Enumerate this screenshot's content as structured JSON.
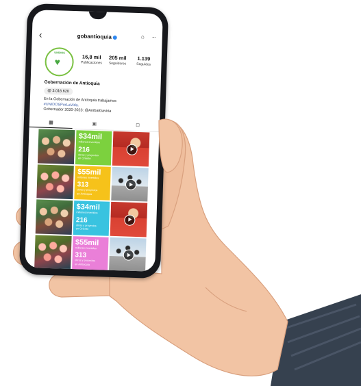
{
  "profile": {
    "handle": "gobantioquia",
    "stats": [
      {
        "value": "16,8 mil",
        "label": "Publicaciones"
      },
      {
        "value": "205 mil",
        "label": "Seguidores"
      },
      {
        "value": "1.139",
        "label": "Seguidos"
      }
    ],
    "name": "Gobernación de Antioquia",
    "threads": "3.016.620",
    "bio_line1": "En la Gobernación de Antioquia trabajamos",
    "bio_hashtag": "#UNIDOSPorLaVida.",
    "bio_line2": "Gobernador 2020-2023: @AníbalGaviria",
    "avatar_text": "UNIDOS"
  },
  "tabs": [
    {
      "icon": "grid-icon",
      "glyph": "▦"
    },
    {
      "icon": "reels-icon",
      "glyph": "▣"
    },
    {
      "icon": "tagged-icon",
      "glyph": "⊡"
    }
  ],
  "posts": {
    "green": {
      "amount": "$34mil",
      "amount_sub": "millones invertidos",
      "count": "216",
      "count_sub": "obras y proyectos",
      "place": "en Oriente"
    },
    "yellow": {
      "amount": "$55mil",
      "amount_sub": "millones invertidos",
      "count": "313",
      "count_sub": "obras y proyectos",
      "place": "en Antioquia"
    },
    "cyan": {
      "amount": "$34mil",
      "amount_sub": "millones invertidos",
      "count": "216",
      "count_sub": "obras y proyectos",
      "place": "en Oriente"
    },
    "pink": {
      "amount": "$55mil",
      "amount_sub": "millones invertidos",
      "count": "313",
      "count_sub": "obras y proyectos",
      "place": "en Antioquia"
    }
  },
  "colors": {
    "green": "#7cd13e",
    "yellow": "#f6c21a",
    "cyan": "#39c3e0",
    "pink": "#ea7fd8",
    "skin": "#f2c4a4",
    "sleeve": "#3a4556"
  }
}
